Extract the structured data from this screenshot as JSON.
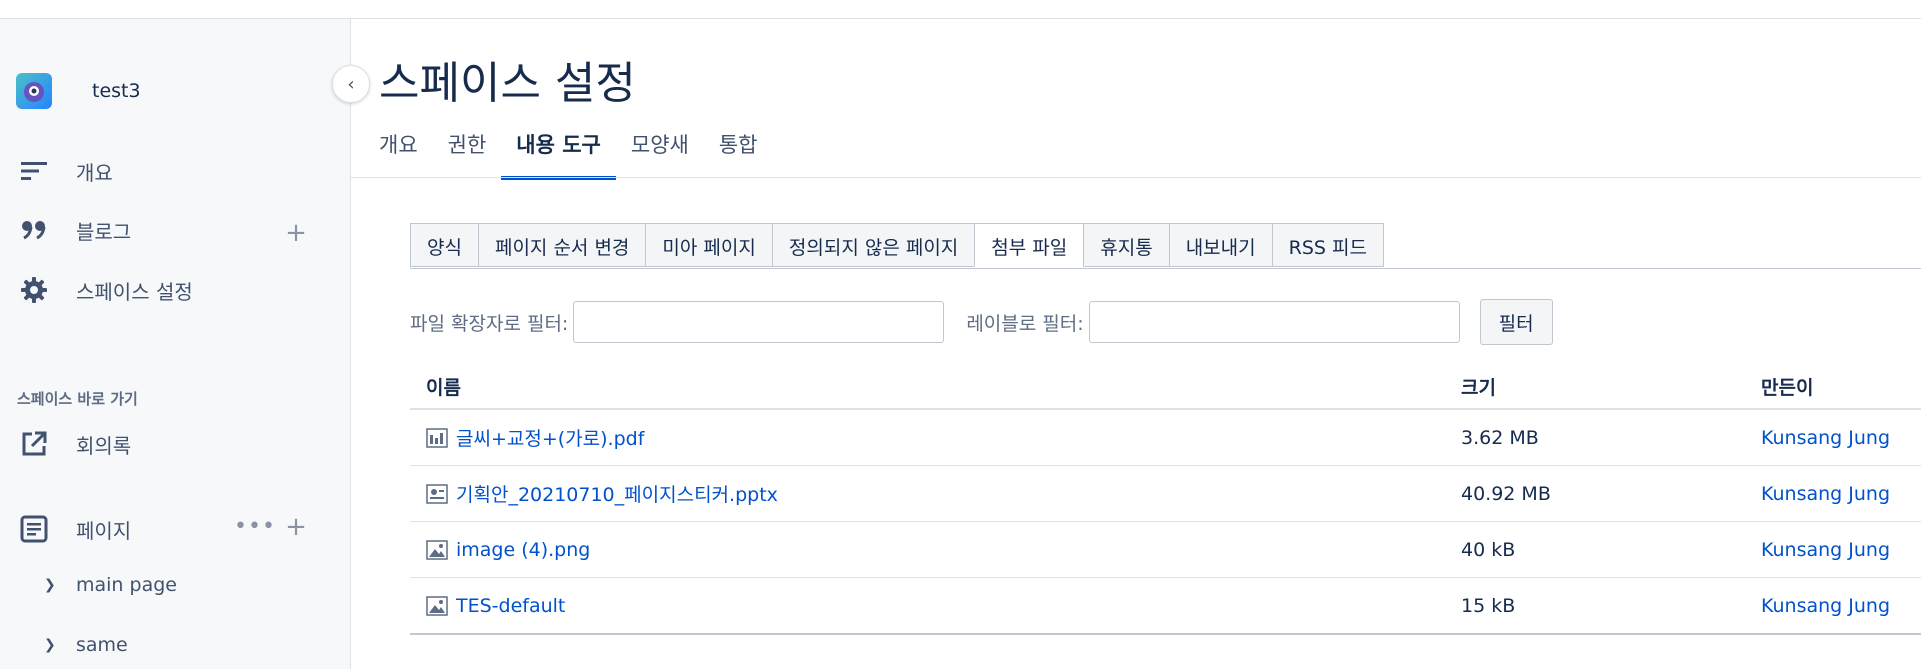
{
  "sidebar": {
    "space_name": "test3",
    "nav": [
      {
        "icon": "overview-icon",
        "label": "개요"
      },
      {
        "icon": "quote-icon",
        "label": "블로그"
      },
      {
        "icon": "gear-icon",
        "label": "스페이스 설정"
      }
    ],
    "shortcuts_title": "스페이스 바로 가기",
    "shortcut": {
      "icon": "external-link-icon",
      "label": "회의록"
    },
    "pages": {
      "icon": "page-icon",
      "label": "페이지"
    },
    "tree": [
      {
        "label": "main page"
      },
      {
        "label": "same"
      }
    ]
  },
  "main": {
    "title": "스페이스 설정",
    "tabs": [
      {
        "label": "개요"
      },
      {
        "label": "권한"
      },
      {
        "label": "내용 도구",
        "active": true
      },
      {
        "label": "모양새"
      },
      {
        "label": "통합"
      }
    ],
    "subtabs": [
      {
        "label": "양식"
      },
      {
        "label": "페이지 순서 변경"
      },
      {
        "label": "미아 페이지"
      },
      {
        "label": "정의되지 않은 페이지"
      },
      {
        "label": "첨부 파일",
        "active": true
      },
      {
        "label": "휴지통"
      },
      {
        "label": "내보내기"
      },
      {
        "label": "RSS 피드"
      }
    ],
    "filter": {
      "extension_label": "파일 확장자로 필터:",
      "label_label": "레이블로 필터:",
      "button": "필터"
    },
    "table": {
      "headers": {
        "name": "이름",
        "size": "크기",
        "creator": "만든이"
      },
      "rows": [
        {
          "icon": "pdf-file-icon",
          "name": "글씨+교정+(가로).pdf",
          "size": "3.62 MB",
          "creator": "Kunsang Jung"
        },
        {
          "icon": "presentation-file-icon",
          "name": "기획안_20210710_페이지스티커.pptx",
          "size": "40.92 MB",
          "creator": "Kunsang Jung"
        },
        {
          "icon": "image-file-icon",
          "name": "image (4).png",
          "size": "40 kB",
          "creator": "Kunsang Jung"
        },
        {
          "icon": "image-file-icon",
          "name": "TES-default",
          "size": "15 kB",
          "creator": "Kunsang Jung"
        }
      ]
    }
  },
  "colors": {
    "accent": "#0052cc",
    "sidebar_bg": "#f7f8fa",
    "text": "#172b4d"
  }
}
